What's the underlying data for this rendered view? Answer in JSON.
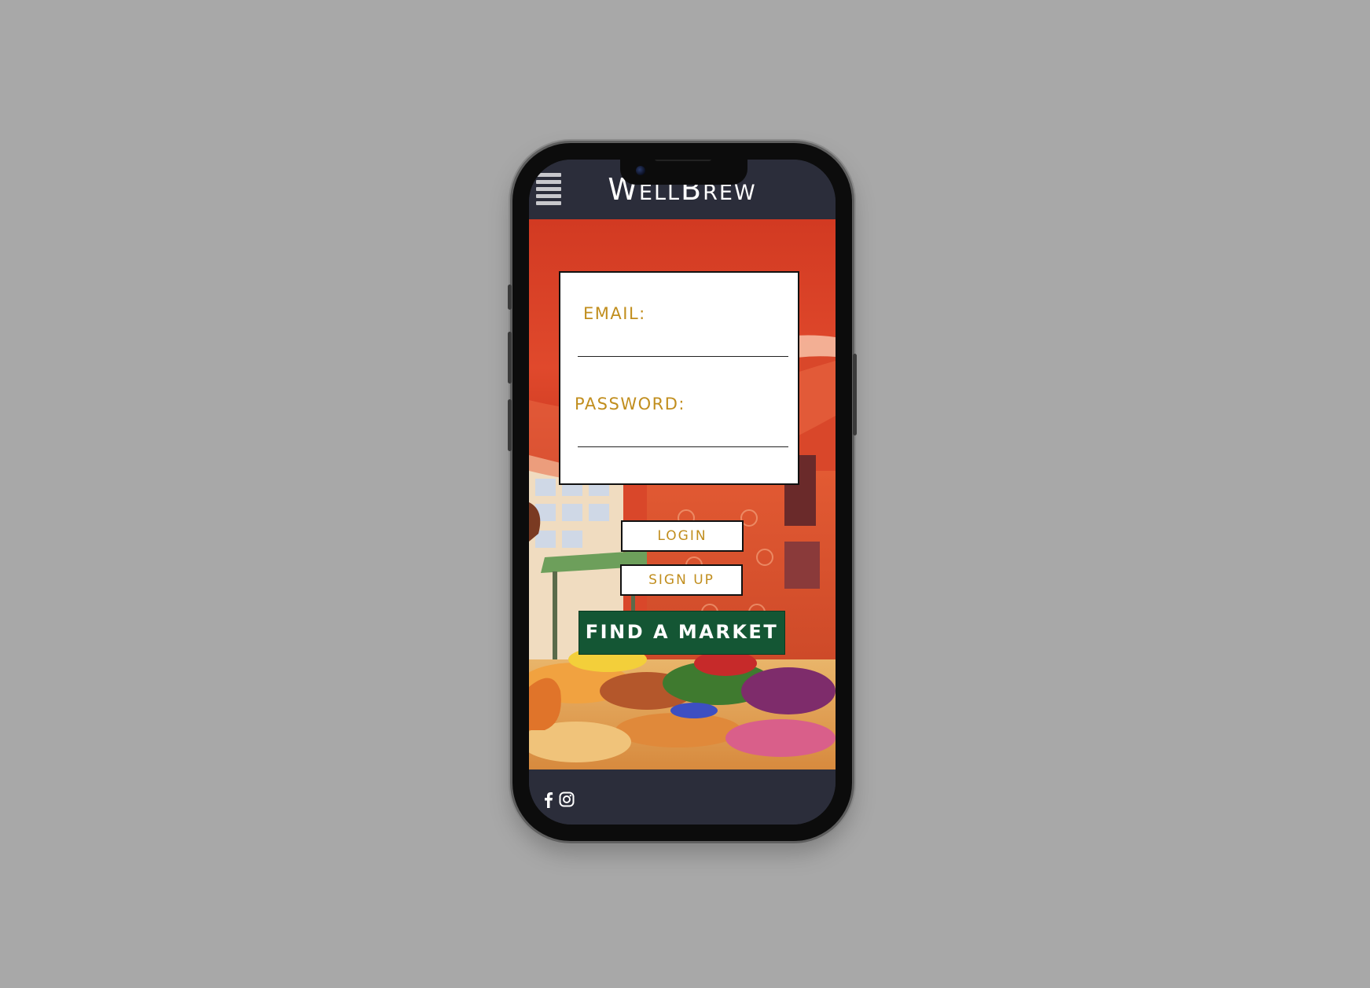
{
  "header": {
    "brand": "WellBrew",
    "menu_icon": "hamburger-menu-icon"
  },
  "login": {
    "email_label": "EMAIL:",
    "email_value": "",
    "password_label": "PASSWORD:",
    "password_value": ""
  },
  "actions": {
    "login_label": "LOGIN",
    "signup_label": "SIGN UP",
    "find_market_label": "FIND A MARKET"
  },
  "footer": {
    "social_icons": [
      "facebook-icon",
      "instagram-icon"
    ]
  },
  "colors": {
    "page_background": "#a8a8a8",
    "header_footer": "#2b2d3a",
    "label_gold": "#c18e1e",
    "market_button_green": "#145634",
    "hero_red": "#d9472a"
  }
}
